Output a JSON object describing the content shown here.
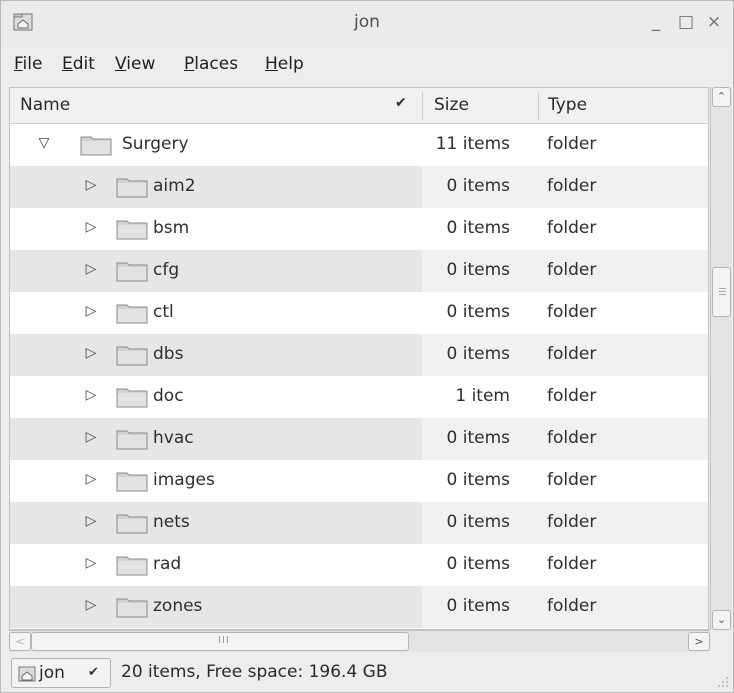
{
  "window": {
    "title": "jon"
  },
  "menubar": {
    "items": [
      "File",
      "Edit",
      "View",
      "Places",
      "Help"
    ]
  },
  "columns": {
    "name": "Name",
    "size": "Size",
    "type": "Type"
  },
  "tree": {
    "parent": {
      "name": "Surgery",
      "size": "11 items",
      "type": "folder",
      "expanded": true
    },
    "children": [
      {
        "name": "aim2",
        "size": "0 items",
        "type": "folder"
      },
      {
        "name": "bsm",
        "size": "0 items",
        "type": "folder"
      },
      {
        "name": "cfg",
        "size": "0 items",
        "type": "folder"
      },
      {
        "name": "ctl",
        "size": "0 items",
        "type": "folder"
      },
      {
        "name": "dbs",
        "size": "0 items",
        "type": "folder"
      },
      {
        "name": "doc",
        "size": "1 item",
        "type": "folder"
      },
      {
        "name": "hvac",
        "size": "0 items",
        "type": "folder"
      },
      {
        "name": "images",
        "size": "0 items",
        "type": "folder"
      },
      {
        "name": "nets",
        "size": "0 items",
        "type": "folder"
      },
      {
        "name": "rad",
        "size": "0 items",
        "type": "folder"
      },
      {
        "name": "zones",
        "size": "0 items",
        "type": "folder"
      }
    ]
  },
  "statusbar": {
    "location": "jon",
    "info": "20 items, Free space: 196.4 GB"
  },
  "icons": {
    "folder": "folder-icon",
    "home": "home-folder-icon"
  }
}
